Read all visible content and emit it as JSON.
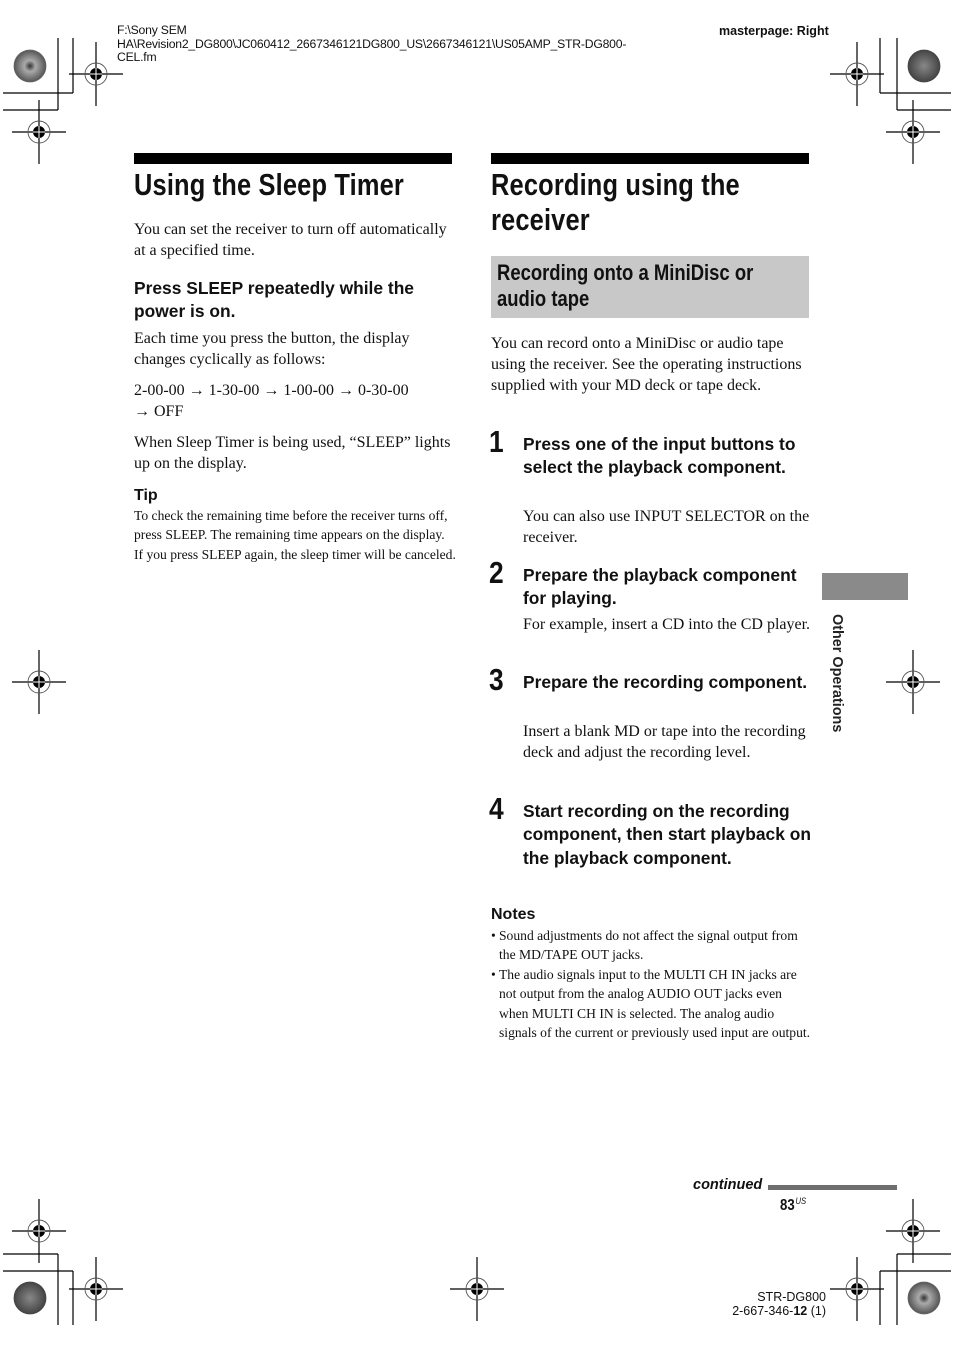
{
  "header": {
    "file_path_lines": [
      "F:\\Sony SEM",
      "HA\\Revision2_DG800\\JC060412_2667346121DG800_US\\2667346121\\US05AMP_STR-DG800-",
      "CEL.fm"
    ],
    "masterpage": "masterpage: Right"
  },
  "left_section": {
    "title": "Using the Sleep Timer",
    "intro": "You can set the receiver to turn off automatically at a specified time.",
    "instruction": "Press SLEEP repeatedly while the power is on.",
    "cycle_intro": "Each time you press the button, the display changes cyclically as follows:",
    "cycle": [
      "2-00-00",
      "1-30-00",
      "1-00-00",
      "0-30-00",
      "OFF"
    ],
    "arrow_glyph": "→",
    "when_text": "When Sleep Timer is being used, “SLEEP” lights up on the display.",
    "tip_label": "Tip",
    "tip_text": "To check the remaining time before the receiver turns off, press SLEEP. The remaining time appears on the display. If you press SLEEP again, the sleep timer will be canceled."
  },
  "right_section": {
    "title_lines": [
      "Recording using the",
      "receiver"
    ],
    "subtitle_lines": [
      "Recording onto a MiniDisc or",
      "audio tape"
    ],
    "intro": "You can record onto a MiniDisc or audio tape using the receiver. See the operating instructions supplied with your MD deck or tape deck.",
    "steps": [
      {
        "number": "1",
        "heading": "Press one of the input buttons to select the playback component.",
        "body": "You can also use INPUT SELECTOR on the receiver."
      },
      {
        "number": "2",
        "heading": "Prepare the playback component for playing.",
        "body": "For example, insert a CD into the CD player."
      },
      {
        "number": "3",
        "heading": "Prepare the recording component.",
        "body": "Insert a blank MD or tape into the recording deck and adjust the recording level."
      },
      {
        "number": "4",
        "heading": "Start recording on the recording component, then start playback on the playback component.",
        "body": ""
      }
    ],
    "notes_label": "Notes",
    "bullet_glyph": "•",
    "notes": [
      "Sound adjustments do not affect the signal output from the MD/TAPE OUT jacks.",
      "The audio signals input to the MULTI CH IN jacks are not output from the analog AUDIO OUT jacks even when MULTI CH IN is selected. The analog audio signals of the current or previously used input are output."
    ]
  },
  "side_tab": {
    "label": "Other Operations",
    "color": "#8a8a8a"
  },
  "footer": {
    "continued": "continued",
    "page_number": "83",
    "page_suffix": "US",
    "model": "STR-DG800",
    "part_number_prefix": "2-667-346-",
    "part_number_bold": "12",
    "part_number_suffix": " (1)"
  },
  "colors": {
    "subheading_bg": "#c8c8c8",
    "continued_bar": "#6e6e6e",
    "text": "#111111"
  }
}
